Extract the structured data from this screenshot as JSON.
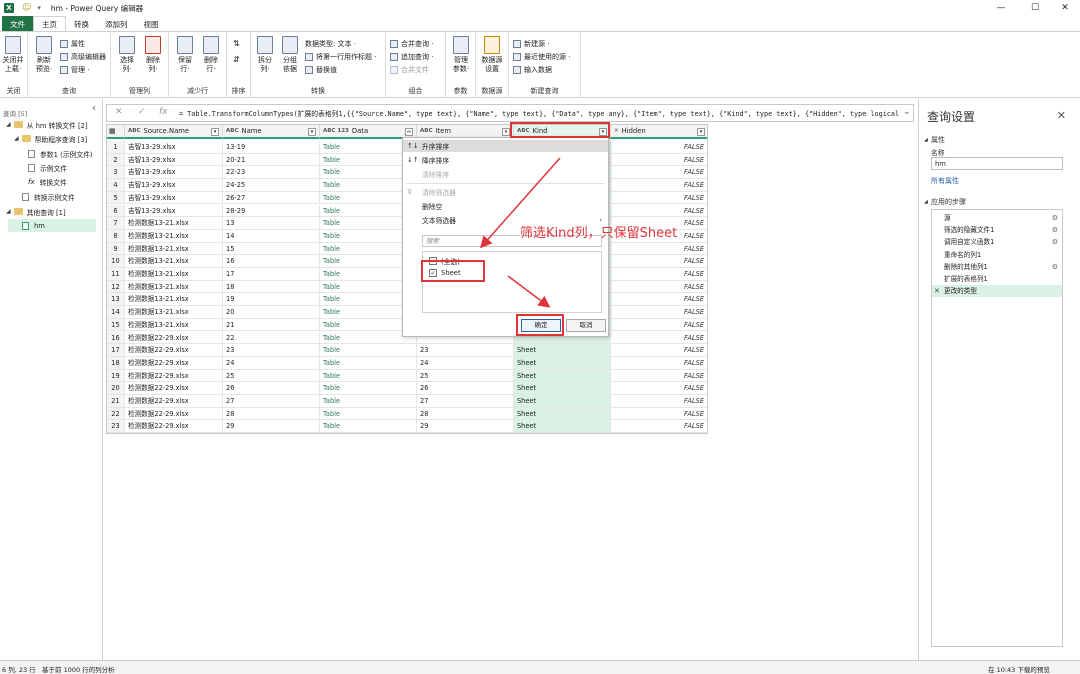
{
  "titlebar": {
    "app_icon": "X",
    "title": "hm - Power Query 编辑器",
    "min": "—",
    "max": "☐",
    "close": "✕"
  },
  "menu": {
    "tabs": [
      "文件",
      "主页",
      "转换",
      "添加列",
      "视图"
    ]
  },
  "ribbon": {
    "groups": {
      "close": {
        "btn": "关闭并\n上载·",
        "label": "关闭"
      },
      "query": {
        "refresh": "刷新\n预览·",
        "properties": "属性",
        "advanced": "高级编辑器",
        "manage": "管理 ·",
        "label": "查询"
      },
      "columns": {
        "choose": "选择\n列·",
        "remove": "删除\n列·",
        "label": "管理列"
      },
      "rows": {
        "keep": "保留\n行·",
        "remove": "删除\n行·",
        "label": "减少行"
      },
      "sort": {
        "label": "排序"
      },
      "transform": {
        "split": "拆分\n列·",
        "group": "分组\n依据",
        "datatype": "数据类型: 文本 ·",
        "first_row": "将第一行用作标题 ·",
        "replace": "替换值",
        "label": "转换"
      },
      "combine": {
        "merge": "合并查询 ·",
        "append": "追加查询 ·",
        "merge_files": "合并文件",
        "label": "组合"
      },
      "params": {
        "manage": "管理\n参数·",
        "label": "参数"
      },
      "datasource": {
        "settings": "数据源\n设置",
        "label": "数据源"
      },
      "newquery": {
        "new_source": "新建源 ·",
        "recent": "最近使用的源 ·",
        "enter": "输入数据",
        "label": "新建查询"
      }
    }
  },
  "left_pane": {
    "header": "查询 [5]",
    "collapse": "‹",
    "items": [
      {
        "label": "从 hm 转换文件 [2]",
        "kind": "folder"
      },
      {
        "label": "帮助程序查询 [3]",
        "kind": "folder"
      },
      {
        "label": "参数1 (示例文件)",
        "kind": "doc"
      },
      {
        "label": "示例文件",
        "kind": "doc"
      },
      {
        "label": "转换文件",
        "kind": "fx"
      },
      {
        "label": "转换示例文件",
        "kind": "doc"
      },
      {
        "label": "其他查询 [1]",
        "kind": "folder"
      },
      {
        "label": "hm",
        "kind": "table"
      }
    ]
  },
  "formula_bar": {
    "cancel": "✕",
    "confirm": "✓",
    "fx": "fx",
    "text": "= Table.TransformColumnTypes(扩展的表格列1,{{\"Source.Name\", type text}, {\"Name\", type text}, {\"Data\", type any}, {\"Item\", type text}, {\"Kind\", type text}, {\"Hidden\", type logical}})",
    "expand": "⌄"
  },
  "grid": {
    "columns": [
      {
        "type": "ABC",
        "name": "Source.Name"
      },
      {
        "type": "ABC",
        "name": "Name"
      },
      {
        "type": "ABC 123",
        "name": "Data"
      },
      {
        "type": "ABC",
        "name": "Item"
      },
      {
        "type": "ABC",
        "name": "Kind"
      },
      {
        "type": "✕",
        "name": "Hidden"
      }
    ],
    "rows": [
      {
        "n": "1",
        "src": "吉智13-29.xlsx",
        "name": "13-19",
        "data": "Table",
        "item": "",
        "kind": "",
        "hidden": "FALSE"
      },
      {
        "n": "2",
        "src": "吉智13-29.xlsx",
        "name": "20-21",
        "data": "Table",
        "item": "",
        "kind": "",
        "hidden": "FALSE"
      },
      {
        "n": "3",
        "src": "吉智13-29.xlsx",
        "name": "22-23",
        "data": "Table",
        "item": "",
        "kind": "",
        "hidden": "FALSE"
      },
      {
        "n": "4",
        "src": "吉智13-29.xlsx",
        "name": "24-25",
        "data": "Table",
        "item": "",
        "kind": "",
        "hidden": "FALSE"
      },
      {
        "n": "5",
        "src": "吉智13-29.xlsx",
        "name": "26-27",
        "data": "Table",
        "item": "",
        "kind": "",
        "hidden": "FALSE"
      },
      {
        "n": "6",
        "src": "吉智13-29.xlsx",
        "name": "28-29",
        "data": "Table",
        "item": "",
        "kind": "",
        "hidden": "FALSE"
      },
      {
        "n": "7",
        "src": "检测数据13-21.xlsx",
        "name": "13",
        "data": "Table",
        "item": "",
        "kind": "",
        "hidden": "FALSE"
      },
      {
        "n": "8",
        "src": "检测数据13-21.xlsx",
        "name": "14",
        "data": "Table",
        "item": "",
        "kind": "",
        "hidden": "FALSE"
      },
      {
        "n": "9",
        "src": "检测数据13-21.xlsx",
        "name": "15",
        "data": "Table",
        "item": "",
        "kind": "",
        "hidden": "FALSE"
      },
      {
        "n": "10",
        "src": "检测数据13-21.xlsx",
        "name": "16",
        "data": "Table",
        "item": "",
        "kind": "",
        "hidden": "FALSE"
      },
      {
        "n": "11",
        "src": "检测数据13-21.xlsx",
        "name": "17",
        "data": "Table",
        "item": "",
        "kind": "",
        "hidden": "FALSE"
      },
      {
        "n": "12",
        "src": "检测数据13-21.xlsx",
        "name": "18",
        "data": "Table",
        "item": "",
        "kind": "",
        "hidden": "FALSE"
      },
      {
        "n": "13",
        "src": "检测数据13-21.xlsx",
        "name": "19",
        "data": "Table",
        "item": "",
        "kind": "",
        "hidden": "FALSE"
      },
      {
        "n": "14",
        "src": "检测数据13-21.xlsx",
        "name": "20",
        "data": "Table",
        "item": "",
        "kind": "",
        "hidden": "FALSE"
      },
      {
        "n": "15",
        "src": "检测数据13-21.xlsx",
        "name": "21",
        "data": "Table",
        "item": "",
        "kind": "",
        "hidden": "FALSE"
      },
      {
        "n": "16",
        "src": "检测数据22-29.xlsx",
        "name": "22",
        "data": "Table",
        "item": "",
        "kind": "",
        "hidden": "FALSE"
      },
      {
        "n": "17",
        "src": "检测数据22-29.xlsx",
        "name": "23",
        "data": "Table",
        "item": "23",
        "kind": "Sheet",
        "hidden": "FALSE"
      },
      {
        "n": "18",
        "src": "检测数据22-29.xlsx",
        "name": "24",
        "data": "Table",
        "item": "24",
        "kind": "Sheet",
        "hidden": "FALSE"
      },
      {
        "n": "19",
        "src": "检测数据22-29.xlsx",
        "name": "25",
        "data": "Table",
        "item": "25",
        "kind": "Sheet",
        "hidden": "FALSE"
      },
      {
        "n": "20",
        "src": "检测数据22-29.xlsx",
        "name": "26",
        "data": "Table",
        "item": "26",
        "kind": "Sheet",
        "hidden": "FALSE"
      },
      {
        "n": "21",
        "src": "检测数据22-29.xlsx",
        "name": "27",
        "data": "Table",
        "item": "27",
        "kind": "Sheet",
        "hidden": "FALSE"
      },
      {
        "n": "22",
        "src": "检测数据22-29.xlsx",
        "name": "28",
        "data": "Table",
        "item": "28",
        "kind": "Sheet",
        "hidden": "FALSE"
      },
      {
        "n": "23",
        "src": "检测数据22-29.xlsx",
        "name": "29",
        "data": "Table",
        "item": "29",
        "kind": "Sheet",
        "hidden": "FALSE"
      }
    ]
  },
  "filter_popup": {
    "sort_asc": "升序排序",
    "sort_desc": "降序排序",
    "clear_sort": "清除排序",
    "clear_filter": "清除筛选器",
    "remove_empty": "删除空",
    "text_filters": "文本筛选器",
    "search_placeholder": "搜索",
    "select_all": "(全选)",
    "option_sheet": "Sheet",
    "ok": "确定",
    "cancel": "取消"
  },
  "annotation": {
    "text": "筛选Kind列，只保留Sheet",
    "color": "#e0343b"
  },
  "right_pane": {
    "title": "查询设置",
    "close": "✕",
    "properties_header": "属性",
    "name_label": "名称",
    "name_value": "hm",
    "all_properties": "所有属性",
    "steps_header": "应用的步骤",
    "steps": [
      {
        "label": "源",
        "gear": true
      },
      {
        "label": "筛选的隐藏文件1",
        "gear": true
      },
      {
        "label": "调用自定义函数1",
        "gear": true
      },
      {
        "label": "重命名的列1",
        "gear": false
      },
      {
        "label": "删除的其他列1",
        "gear": true
      },
      {
        "label": "扩展的表格列1",
        "gear": false
      },
      {
        "label": "更改的类型",
        "gear": false,
        "selected": true
      }
    ]
  },
  "status_bar": {
    "left": "6 列, 23 行",
    "middle": "基于前 1000 行的列分析",
    "right": "在 10:43 下载的预览"
  },
  "colors": {
    "excel_green": "#217346",
    "accent_teal": "#2d9f7a",
    "annotation_red": "#e0343b"
  }
}
